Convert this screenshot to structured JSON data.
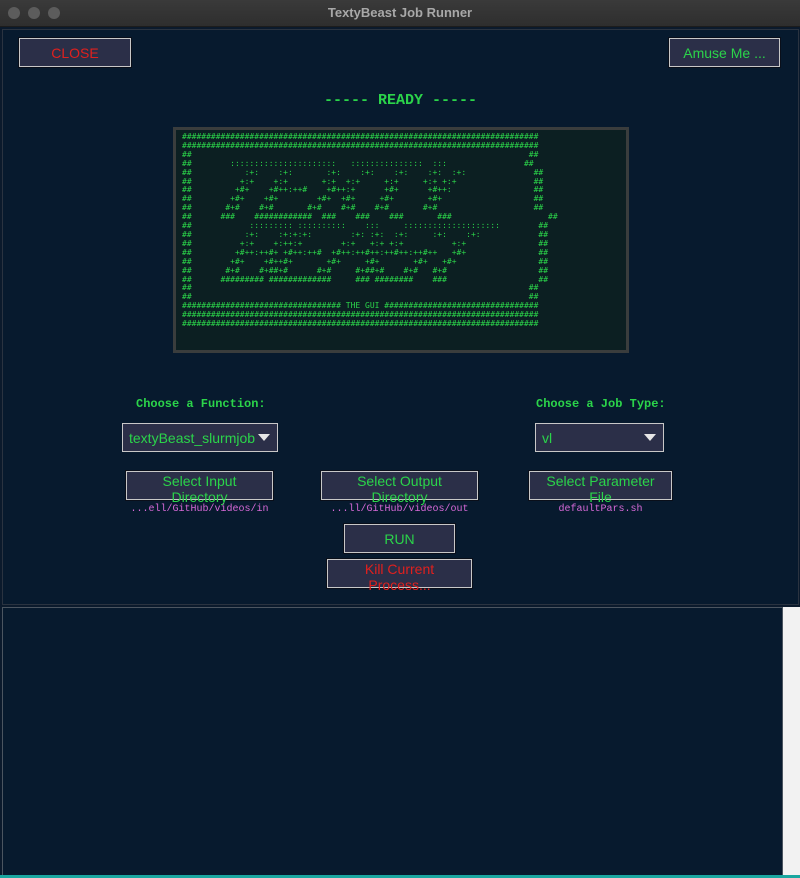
{
  "window": {
    "title": "TextyBeast Job Runner"
  },
  "toolbar": {
    "close_label": "CLOSE",
    "amuse_label": "Amuse Me ..."
  },
  "status": {
    "ready_text": "----- READY -----"
  },
  "banner": {
    "ascii": "##########################################################################\n##########################################################################\n##                                                                      ##\n##        ::::::::::::::::::::::   :::::::::::::::  :::                ##\n##           :+:    :+:       :+:    :+:    :+:    :+:  :+:              ##\n##          +:+    +:+       +:+  +:+     +:+     +:+ +:+                ##\n##         +#+    +#++:++#    +#++:+      +#+      +#++:                 ##\n##        +#+    +#+        +#+  +#+     +#+       +#+                   ##\n##       #+#    #+#       #+#    #+#    #+#       #+#                    ##\n##      ###    ############  ###    ###    ###       ###                    ##\n##            ::::::::: ::::::::::    :::     ::::::::::::::::::::        ##\n##           :+:    :+:+:+:        :+: :+:  :+:     :+:    :+:            ##\n##          +:+    +:++:+        +:+   +:+ +:+          +:+               ##\n##         +#++:++#+ +#++:++#  +#++:++#++:++#++:++#++   +#+               ##\n##        +#+    +#++#+       +#+     +#+       +#+   +#+                 ##\n##       #+#    #+##+#      #+#     #+##+#    #+#   #+#                   ##\n##      ######### #############     ### ########    ###                   ##\n##                                                                      ##\n##                                                                      ##\n################################# THE GUI ################################\n##########################################################################\n##########################################################################"
  },
  "controls": {
    "function_label": "Choose a Function:",
    "function_value": "textyBeast_slurmjob",
    "jobtype_label": "Choose a Job Type:",
    "jobtype_value": "vl",
    "input_dir_label": "Select Input Directory",
    "output_dir_label": "Select Output Directory",
    "param_file_label": "Select Parameter File",
    "input_dir_value": "...ell/GitHub/videos/in",
    "output_dir_value": "...ll/GitHub/videos/out",
    "param_file_value": "defaultPars.sh",
    "run_label": "RUN",
    "kill_label": "Kill Current Process..."
  },
  "colors": {
    "green": "#2bd44a",
    "red": "#e0201e",
    "magenta": "#d86ad8",
    "background": "#071a2e",
    "button": "#2b2f48"
  }
}
